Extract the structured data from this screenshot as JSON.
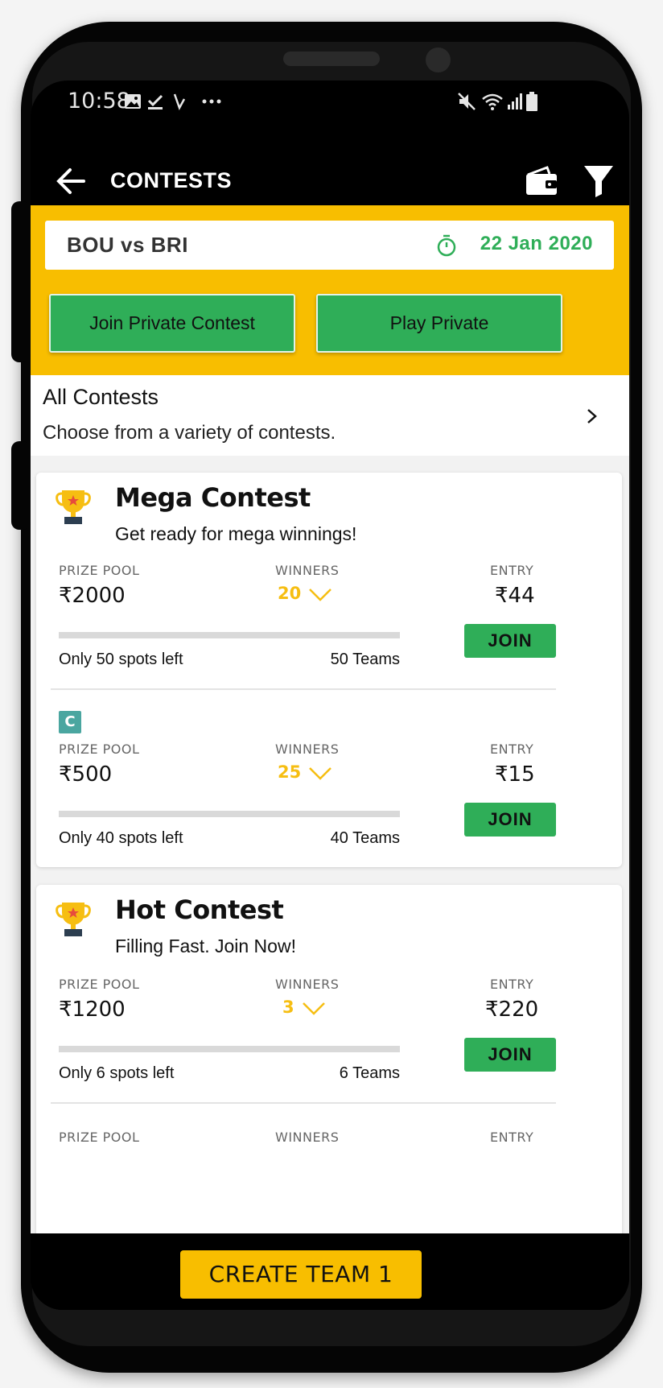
{
  "status_bar": {
    "time": "10:58"
  },
  "app_bar": {
    "title": "CONTESTS"
  },
  "match": {
    "name": "BOU vs BRI",
    "date": "22 Jan 2020"
  },
  "actions": {
    "join_private": "Join Private Contest",
    "play_private": "Play Private"
  },
  "all_contests": {
    "title": "All Contests",
    "subtitle": "Choose from a variety of contests."
  },
  "labels": {
    "prize_pool": "PRIZE POOL",
    "winners": "WINNERS",
    "entry": "ENTRY",
    "join": "JOIN"
  },
  "cards": [
    {
      "title": "Mega Contest",
      "subtitle": "Get ready for mega winnings!",
      "contests": [
        {
          "prize": "₹2000",
          "winners": "20",
          "entry": "₹44",
          "spots": "Only 50 spots left",
          "teams": "50 Teams",
          "filled_fraction": 0.0
        },
        {
          "badge": "C",
          "prize": "₹500",
          "winners": "25",
          "entry": "₹15",
          "spots": "Only 40 spots left",
          "teams": "40 Teams",
          "filled_fraction": 0.0
        }
      ]
    },
    {
      "title": "Hot Contest",
      "subtitle": "Filling Fast. Join Now!",
      "contests": [
        {
          "prize": "₹1200",
          "winners": "3",
          "entry": "₹220",
          "spots": "Only 6 spots left",
          "teams": "6 Teams",
          "filled_fraction": 0.0
        }
      ]
    }
  ],
  "bottom": {
    "create_team": "CREATE TEAM 1"
  },
  "colors": {
    "brand_yellow": "#f8be00",
    "green": "#2fae58",
    "black": "#000000"
  }
}
